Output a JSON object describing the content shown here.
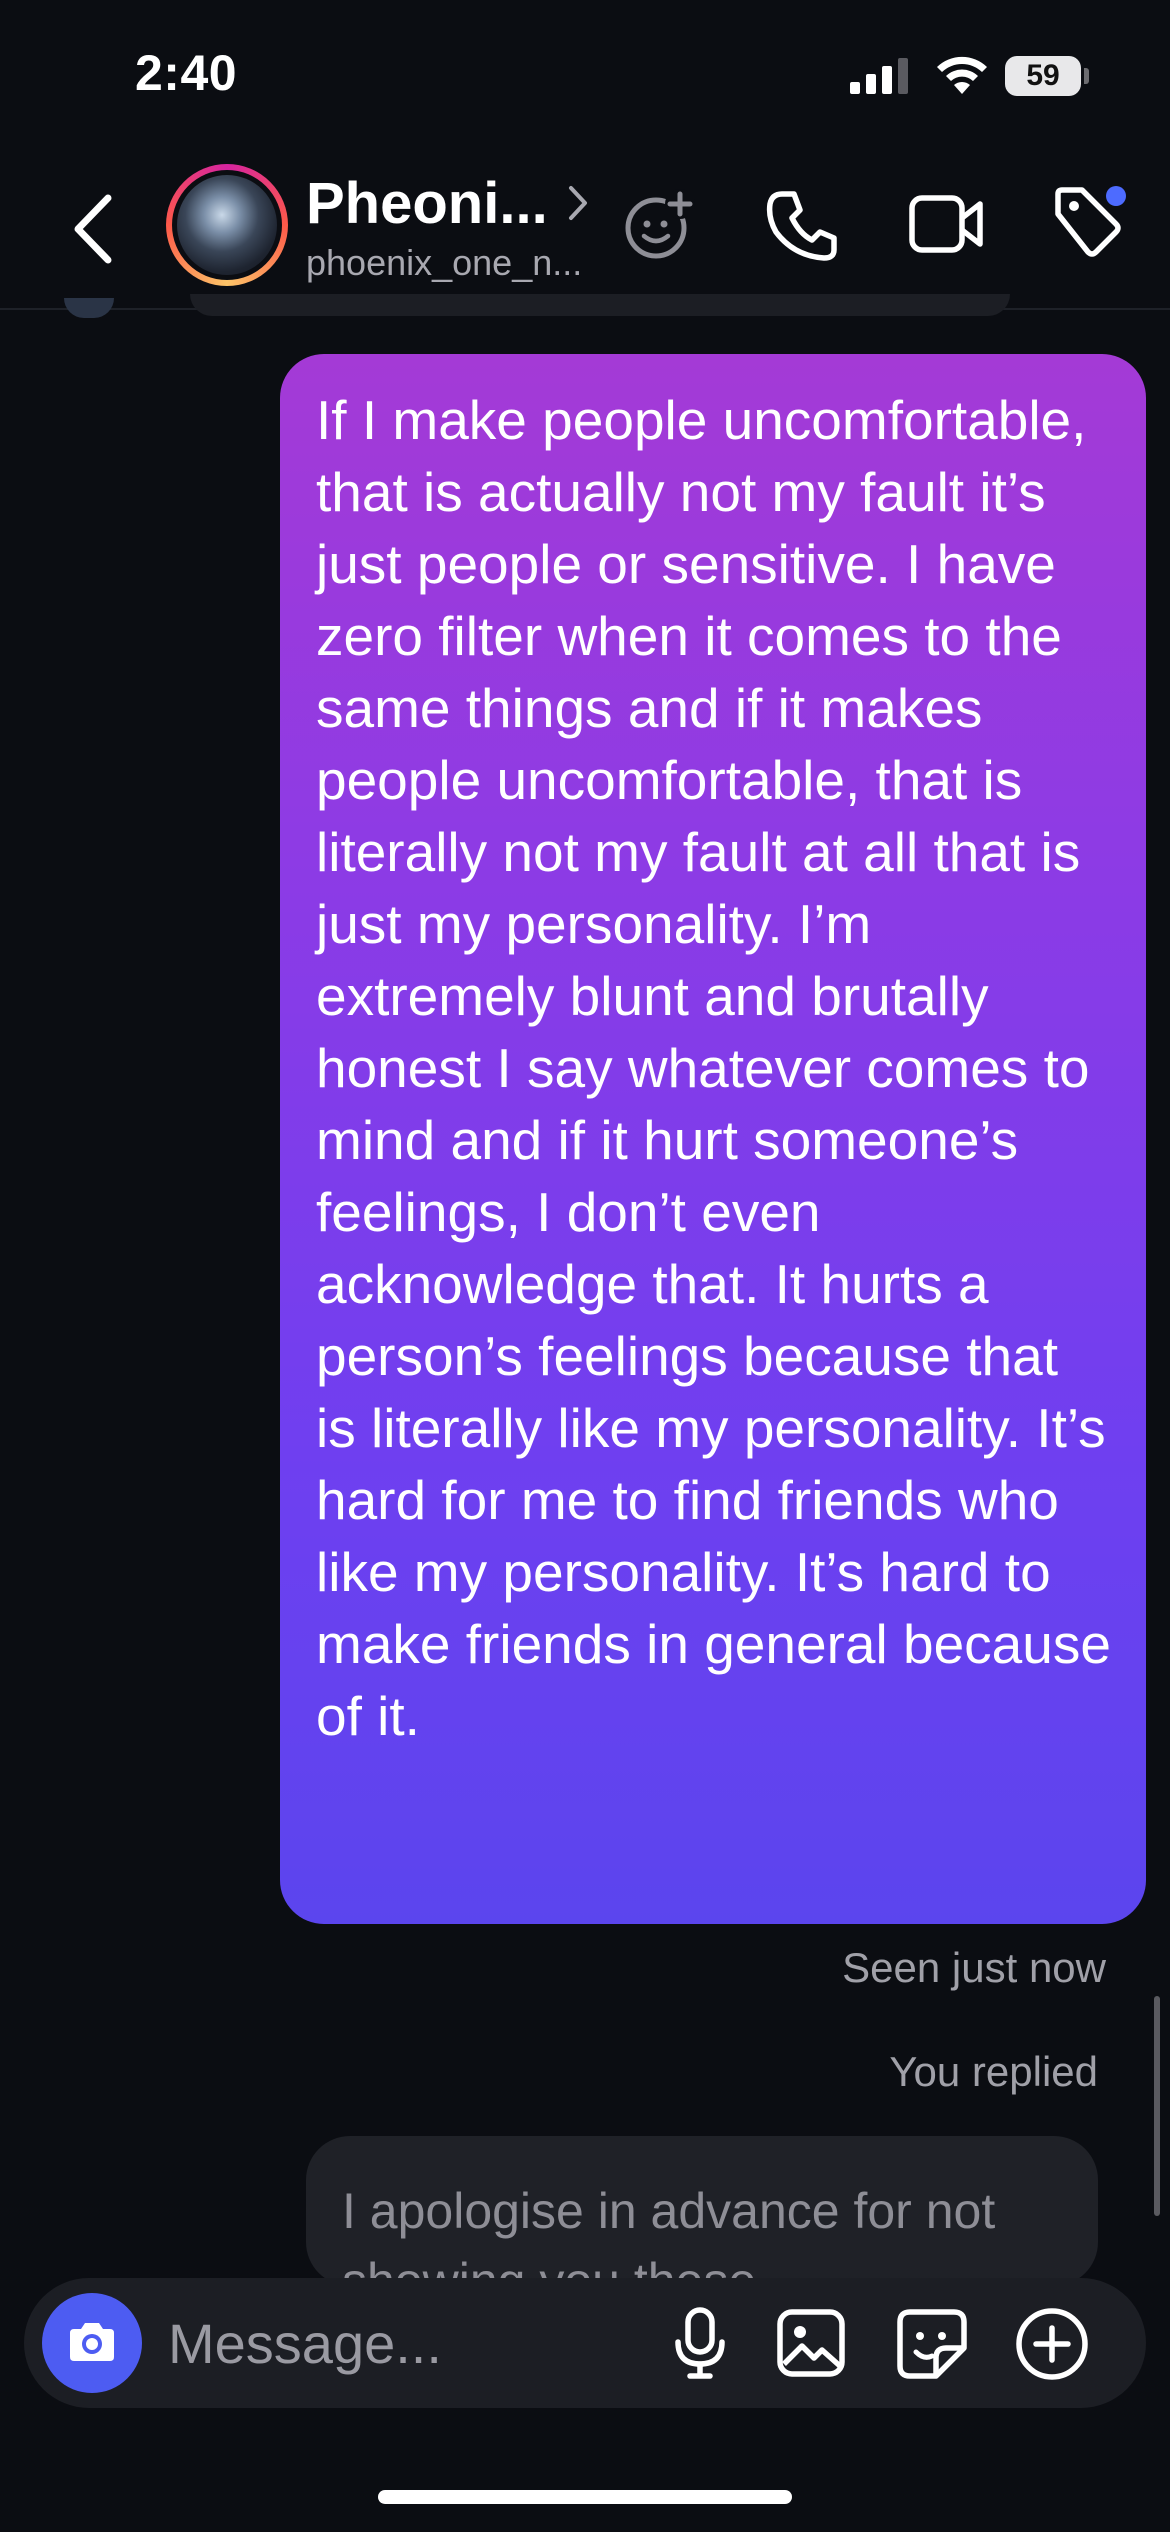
{
  "status_bar": {
    "time": "2:40",
    "battery": "59"
  },
  "header": {
    "contact_name": "Pheoni...",
    "username": "phoenix_one_n...",
    "icons": [
      "back-icon",
      "effects-icon",
      "call-icon",
      "video-icon",
      "tag-icon"
    ],
    "accent_dot_color": "#4d6bff"
  },
  "messages": {
    "sent_text": "If I make people uncomfortable, that is actually not my fault it’s just people or sensitive. I have zero filter when it comes to the same things and if it makes people uncomfortable, that is literally not my fault at all that is just my personality. I’m extremely blunt and brutally honest I say whatever comes to mind and if it hurt someone’s feelings, I don’t even acknowledge that. It hurts a person’s feelings because that is literally like my personality. It’s hard for me to find friends who like my personality. It’s hard to make friends in general because of it.",
    "seen_status": "Seen just now",
    "reply_label": "You replied",
    "reply_text": "I apologise in advance for not showing you these"
  },
  "composer": {
    "placeholder": "Message...",
    "icons": [
      "camera-icon",
      "mic-icon",
      "gallery-icon",
      "sticker-icon",
      "plus-icon"
    ],
    "camera_button_color": "#4d5cf2"
  },
  "colors": {
    "background": "#0b0d12",
    "bubble_gradient_top": "#a43ad6",
    "bubble_gradient_bottom": "#5b45ee"
  }
}
